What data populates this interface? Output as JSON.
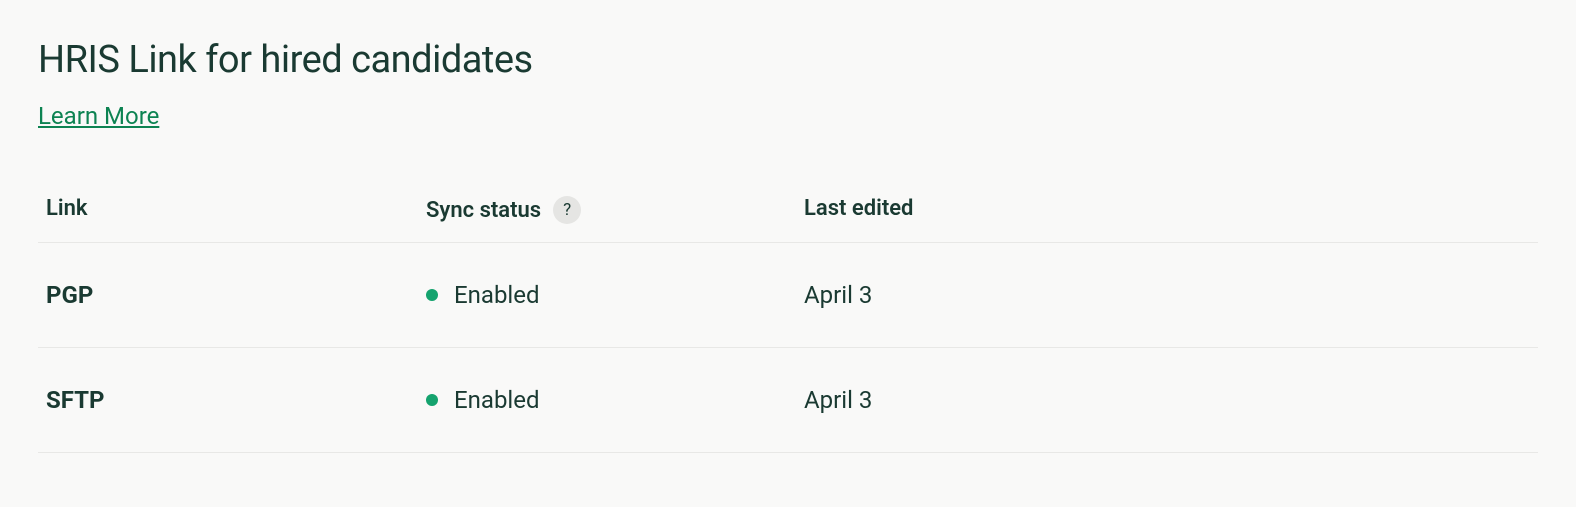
{
  "title": "HRIS Link for hired candidates",
  "learnMoreLabel": "Learn More",
  "table": {
    "headers": {
      "link": "Link",
      "syncStatus": "Sync status",
      "lastEdited": "Last edited"
    },
    "rows": [
      {
        "name": "PGP",
        "status": "Enabled",
        "statusColor": "#15a36e",
        "lastEdited": "April 3"
      },
      {
        "name": "SFTP",
        "status": "Enabled",
        "statusColor": "#15a36e",
        "lastEdited": "April 3"
      }
    ]
  }
}
